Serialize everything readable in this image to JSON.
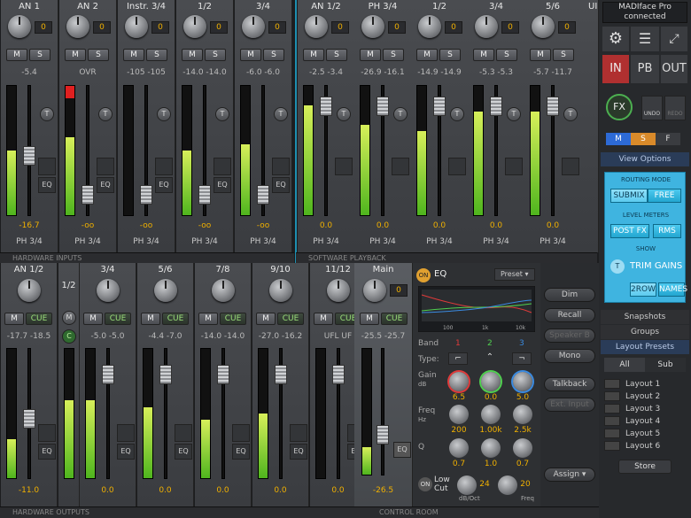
{
  "hardware_inputs": {
    "label": "HARDWARE INPUTS",
    "channels": [
      {
        "name": "AN 1",
        "gain": "0",
        "vals": "-5.4",
        "level": "-16.7",
        "route": "PH 3/4",
        "meter": 0.5,
        "fader": 0.45,
        "clip": false
      },
      {
        "name": "AN 2",
        "gain": "0",
        "vals": "OVR",
        "level": "-oo",
        "route": "PH 3/4",
        "meter": 0.6,
        "fader": 0.1,
        "clip": true
      },
      {
        "name": "Instr. 3/4",
        "gain": "0",
        "vals": "-105  -105",
        "level": "-oo",
        "route": "PH 3/4",
        "meter": 0.0,
        "fader": 0.1,
        "clip": false
      },
      {
        "name": "1/2",
        "gain": "0",
        "vals": "-14.0  -14.0",
        "level": "-oo",
        "route": "PH 3/4",
        "meter": 0.5,
        "fader": 0.1,
        "clip": false
      },
      {
        "name": "3/4",
        "gain": "0",
        "vals": "-6.0  -6.0",
        "level": "-oo",
        "route": "PH 3/4",
        "meter": 0.55,
        "fader": 0.1,
        "clip": false
      }
    ]
  },
  "software_playback": {
    "label": "SOFTWARE PLAYBACK",
    "channels": [
      {
        "name": "AN 1/2",
        "gain": "0",
        "vals": "-2.5  -3.4",
        "level": "0.0",
        "route": "PH 3/4",
        "meter": 0.85,
        "fader": 0.9
      },
      {
        "name": "PH 3/4",
        "gain": "0",
        "vals": "-26.9  -16.1",
        "level": "0.0",
        "route": "PH 3/4",
        "meter": 0.7,
        "fader": 0.9
      },
      {
        "name": "1/2",
        "gain": "0",
        "vals": "-14.9  -14.9",
        "level": "0.0",
        "route": "PH 3/4",
        "meter": 0.65,
        "fader": 0.9
      },
      {
        "name": "3/4",
        "gain": "0",
        "vals": "-5.3  -5.3",
        "level": "0.0",
        "route": "PH 3/4",
        "meter": 0.8,
        "fader": 0.9
      },
      {
        "name": "5/6",
        "gain": "0",
        "vals": "-5.7  -11.7",
        "level": "0.0",
        "route": "PH 3/4",
        "meter": 0.8,
        "fader": 0.9
      },
      {
        "name": "UI",
        "gain": "0",
        "vals": "",
        "level": "",
        "route": "",
        "meter": 0.7,
        "fader": 0.9
      }
    ]
  },
  "hardware_outputs": {
    "label": "HARDWARE OUTPUTS",
    "channels": [
      {
        "name": "AN 1/2",
        "vals": "-17.7  -18.5",
        "level": "-11.0",
        "meter": 0.3,
        "fader": 0.45
      },
      {
        "name": "3/4",
        "vals": "-5.0  -5.0",
        "level": "0.0",
        "meter": 0.6,
        "fader": 0.85
      },
      {
        "name": "5/6",
        "vals": "-4.4  -7.0",
        "level": "0.0",
        "meter": 0.55,
        "fader": 0.85
      },
      {
        "name": "7/8",
        "vals": "-14.0  -14.0",
        "level": "0.0",
        "meter": 0.45,
        "fader": 0.85
      },
      {
        "name": "9/10",
        "vals": "-27.0  -16.2",
        "level": "0.0",
        "meter": 0.5,
        "fader": 0.85
      },
      {
        "name": "11/12",
        "vals": "UFL  UF",
        "level": "0.0",
        "meter": 0.0,
        "fader": 0.85
      }
    ],
    "narrow": {
      "name": "1/2",
      "m": "M",
      "c": "C"
    }
  },
  "main": {
    "name": "Main",
    "gain": "0",
    "vals": "-25.5  -25.7",
    "level": "-26.5"
  },
  "eq": {
    "on": "ON",
    "title": "EQ",
    "preset": "Preset",
    "band_label": "Band",
    "bands": [
      "1",
      "2",
      "3"
    ],
    "type_label": "Type:",
    "gain_label": "Gain",
    "gain_unit": "dB",
    "freq_label": "Freq",
    "freq_unit": "Hz",
    "q_label": "Q",
    "gain_vals": [
      "6.5",
      "0.0",
      "5.0"
    ],
    "freq_vals": [
      "200",
      "1.00k",
      "2.5k"
    ],
    "q_vals": [
      "0.7",
      "1.0",
      "0.7"
    ],
    "lowcut_on": "ON",
    "lowcut_label": "Low Cut",
    "lowcut_slope": "24",
    "lowcut_slope_unit": "dB/Oct",
    "lowcut_freq": "20",
    "lowcut_freq_unit": "Freq",
    "axis": [
      "100",
      "1k",
      "10k"
    ],
    "colors": {
      "band1": "#e03a3a",
      "band2": "#4fd04f",
      "band3": "#3a8ae0"
    }
  },
  "control_room": {
    "label": "CONTROL ROOM",
    "buttons": [
      "Dim",
      "Recall",
      "Speaker B",
      "Mono",
      "Talkback",
      "Ext. Input",
      "Assign"
    ]
  },
  "sidebar": {
    "device": "MADIface Pro",
    "status": "connected",
    "tabs": [
      "IN",
      "PB",
      "OUT"
    ],
    "fx": "FX",
    "undo": "UNDO",
    "redo": "REDO",
    "msf": [
      "M",
      "S",
      "F"
    ],
    "view_options": "View Options",
    "routing_mode": "ROUTING MODE",
    "submix": "SUBMIX",
    "free": "FREE",
    "level_meters": "LEVEL METERS",
    "post_fx": "POST FX",
    "rms": "RMS",
    "show": "SHOW",
    "trim_gains": "TRIM GAINS",
    "two_row": "2ROW",
    "names": "NAMES",
    "snapshots": "Snapshots",
    "groups": "Groups",
    "layout_presets": "Layout Presets",
    "all": "All",
    "sub": "Sub",
    "layouts": [
      "Layout 1",
      "Layout 2",
      "Layout 3",
      "Layout 4",
      "Layout 5",
      "Layout 6"
    ],
    "store": "Store"
  },
  "common": {
    "m": "M",
    "s": "S",
    "t": "T",
    "cue": "CUE",
    "eq": "EQ"
  }
}
